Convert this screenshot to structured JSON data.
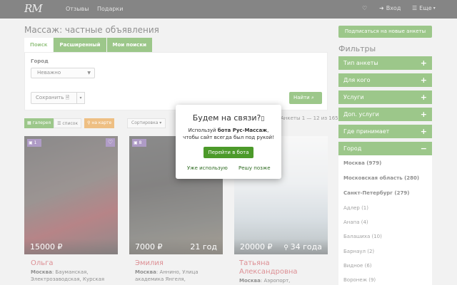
{
  "topbar": {
    "logo": "RM",
    "nav": [
      "Отзывы",
      "Подарки"
    ],
    "login": "Вход",
    "more": "Еще"
  },
  "page": {
    "title": "Массаж: частные объявления",
    "tabs": [
      "Поиск",
      "Расширенный",
      "Мои поиски"
    ],
    "city_label": "Город",
    "city_value": "Неважно",
    "save_label": "Сохранить",
    "find_label": "Найти",
    "view": {
      "gallery": "галерея",
      "list": "список",
      "map": "на карте"
    },
    "sort_label": "Сортировка",
    "count_text": "Анкеты 1 — 12 из 1650"
  },
  "cards": [
    {
      "badge": "1",
      "price": "15000 ₽",
      "age": "",
      "name": "Ольга",
      "city": "Москва",
      "address": "Бауманская, Электрозаводская, Курская"
    },
    {
      "badge": "8",
      "price": "7000 ₽",
      "age": "21 год",
      "name": "Эмилия",
      "city": "Москва",
      "address": "Аннино, Улица академика Янгеля,"
    },
    {
      "badge": "",
      "price": "20000 ₽",
      "age": "34 года",
      "name": "Татьяна Александровна",
      "city": "Москва",
      "address": "Аэропорт,"
    }
  ],
  "sidebar": {
    "subscribe": "Подписаться на новые анкеты",
    "filters_title": "Фильтры",
    "filters": [
      {
        "label": "Тип анкеты",
        "sign": "+"
      },
      {
        "label": "Для кого",
        "sign": "+"
      },
      {
        "label": "Услуги",
        "sign": "+"
      },
      {
        "label": "Доп. услуги",
        "sign": "+"
      },
      {
        "label": "Где принимает",
        "sign": "+"
      },
      {
        "label": "Город",
        "sign": "−"
      }
    ],
    "cities": [
      "Москва (979)",
      "Московская область (280)",
      "Санкт-Петербург (279)",
      "Адлер (1)",
      "Анапа (4)",
      "Балашиха (10)",
      "Барнаул (2)",
      "Видное (6)",
      "Воронеж (9)"
    ]
  },
  "modal": {
    "title": "Будем на связи?",
    "text_prefix": "Используй ",
    "text_bold": "бота Рус-Массаж",
    "text_suffix": ",",
    "text_line2": "чтобы сайт всегда был под рукой!",
    "bot_button": "Перейти в бота",
    "use_link": "Уже использую",
    "later_link": "Решу позже"
  }
}
